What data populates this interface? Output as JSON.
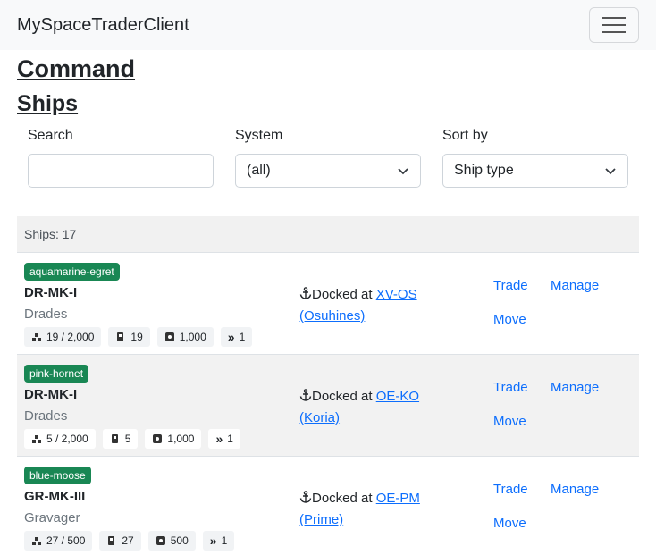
{
  "navbar": {
    "brand": "MySpaceTraderClient"
  },
  "page": {
    "heading": "Command",
    "subheading": "Ships"
  },
  "filters": {
    "search_label": "Search",
    "search_value": "",
    "system_label": "System",
    "system_value": "(all)",
    "sort_label": "Sort by",
    "sort_value": "Ship type"
  },
  "list": {
    "count_text": "Ships: 17",
    "actions": {
      "trade": "Trade",
      "move": "Move",
      "manage": "Manage"
    },
    "ships": [
      {
        "name": "aquamarine-egret",
        "type": "DR-MK-I",
        "class": "Drades",
        "cargo": "19 / 2,000",
        "fuel": "19",
        "speed_stat": "1,000",
        "maneuver": "1",
        "status": "Docked at",
        "location": "XV-OS",
        "location_name": "(Osuhines)"
      },
      {
        "name": "pink-hornet",
        "type": "DR-MK-I",
        "class": "Drades",
        "cargo": "5 / 2,000",
        "fuel": "5",
        "speed_stat": "1,000",
        "maneuver": "1",
        "status": "Docked at",
        "location": "OE-KO",
        "location_name": "(Koria)"
      },
      {
        "name": "blue-moose",
        "type": "GR-MK-III",
        "class": "Gravager",
        "cargo": "27 / 500",
        "fuel": "27",
        "speed_stat": "500",
        "maneuver": "1",
        "status": "Docked at",
        "location": "OE-PM",
        "location_name": "(Prime)"
      }
    ]
  },
  "colors": {
    "badge": "#198754",
    "link": "#0d6efd",
    "navbar_bg": "#f8f9fa"
  }
}
